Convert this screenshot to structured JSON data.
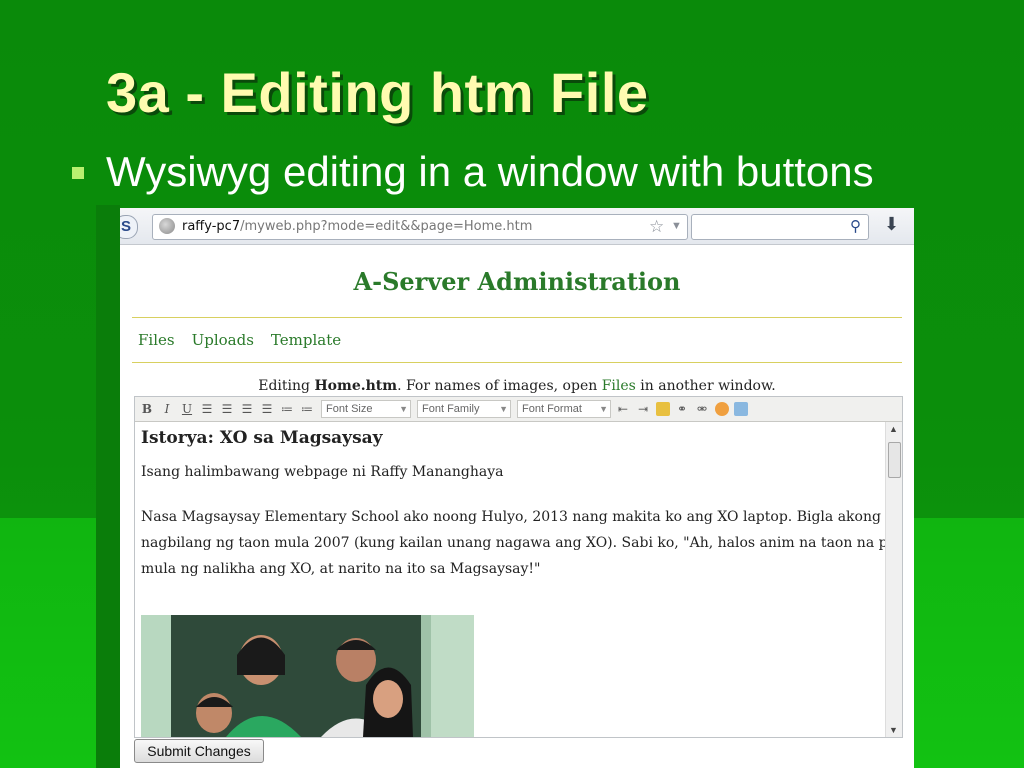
{
  "slide": {
    "title": "3a - Editing htm File",
    "bullet": "Wysiwyg editing in a window with buttons"
  },
  "browser": {
    "url_host": "raffy-pc7",
    "url_path": "/myweb.php?mode=edit&&page=Home.htm",
    "search_placeholder": ""
  },
  "site": {
    "title": "A-Server Administration",
    "nav": [
      "Files",
      "Uploads",
      "Template"
    ],
    "editing_prefix": "Editing ",
    "editing_file": "Home.htm",
    "editing_mid": ". For names of images, open ",
    "editing_link": "Files",
    "editing_suffix": " in another window."
  },
  "editor": {
    "toolbar": {
      "bold": "B",
      "italic": "I",
      "underline": "U",
      "font_size": "Font Size",
      "font_family": "Font Family",
      "font_format": "Font Format"
    },
    "content": {
      "heading": "Istorya: XO sa Magsaysay",
      "subtitle": "Isang halimbawang webpage ni Raffy Mananghaya",
      "paragraph": "Nasa Magsaysay Elementary School ako noong Hulyo, 2013 nang makita ko ang XO laptop. Bigla akong nagbilang ng taon mula 2007 (kung kailan unang nagawa ang XO). Sabi ko, \"Ah, halos anim na taon na pala mula ng nalikha ang XO, at narito na ito sa Magsaysay!\""
    }
  },
  "submit_label": "Submit Changes",
  "colors": {
    "slide_bg": "#0a8a0a",
    "title": "#fffbb0",
    "site_green": "#2a7a2a"
  }
}
